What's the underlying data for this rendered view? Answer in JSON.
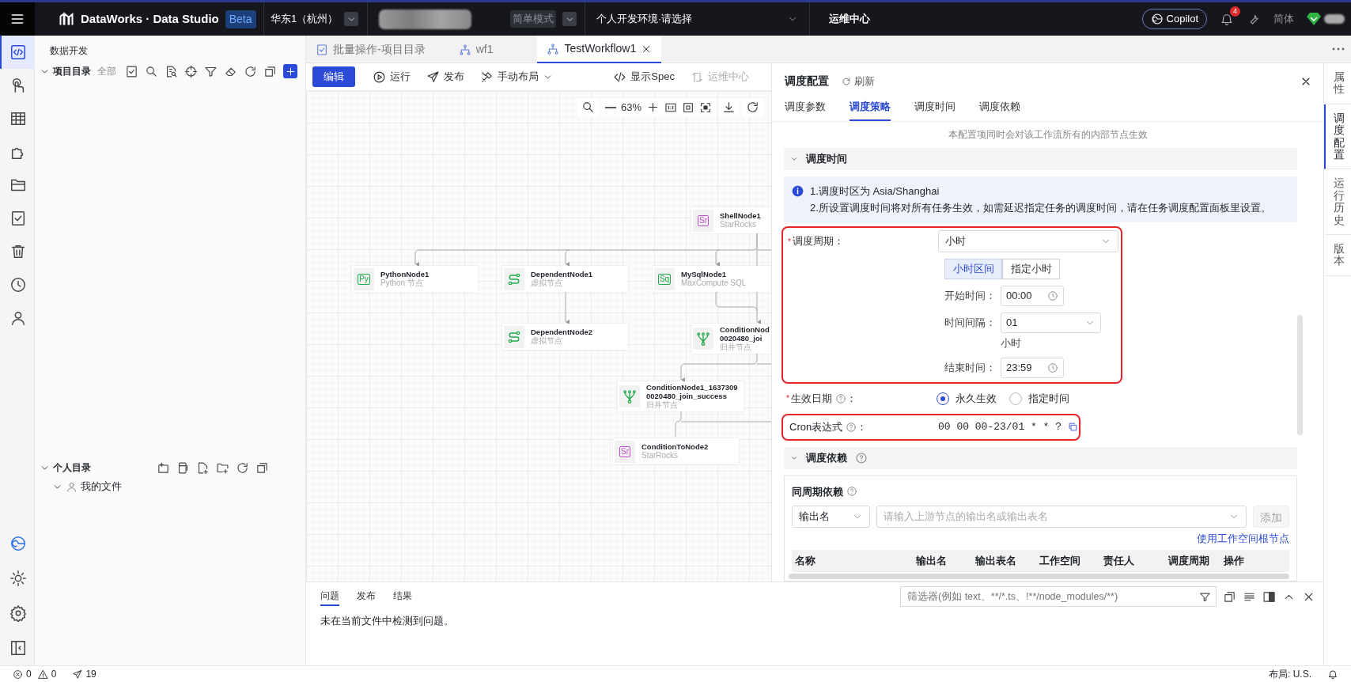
{
  "topbar": {
    "app_title": "DataWorks · Data Studio",
    "badge": "Beta",
    "region": "华东1（杭州）",
    "mode": "简单模式",
    "environment": "个人开发环境·请选择",
    "ops_link": "运维中心",
    "copilot": "Copilot",
    "notifications": "4",
    "language": "简体"
  },
  "activity_bar": {
    "items": [
      {
        "selected": true
      },
      {
        "selected": false
      },
      {
        "selected": false
      },
      {
        "selected": false
      },
      {
        "selected": false
      },
      {
        "selected": false
      },
      {
        "selected": false
      },
      {
        "selected": false
      },
      {
        "selected": false
      }
    ]
  },
  "sidebar": {
    "title": "数据开发",
    "project": {
      "label": "项目目录",
      "filter": "全部",
      "expanded": true
    },
    "personal": {
      "label": "个人目录",
      "expanded": true,
      "items": [
        {
          "label": "我的文件",
          "expanded": true
        }
      ]
    }
  },
  "editor_tabs": [
    {
      "label": "批量操作-项目目录",
      "selected": false,
      "closable": false
    },
    {
      "label": "wf1",
      "selected": false,
      "closable": false
    },
    {
      "label": "TestWorkflow1",
      "selected": true,
      "closable": true
    }
  ],
  "toolbar": [
    {
      "label": "编辑",
      "kind": "primary",
      "disabled": false
    },
    {
      "label": "运行",
      "kind": "run",
      "disabled": false
    },
    {
      "label": "发布",
      "kind": "publish",
      "disabled": false
    },
    {
      "label": "手动布局",
      "kind": "layout",
      "disabled": false
    },
    {
      "label": "显示Spec",
      "kind": "spec",
      "disabled": false
    },
    {
      "label": "运维中心",
      "kind": "ops",
      "disabled": true
    }
  ],
  "canvas": {
    "zoom": "63%",
    "nodes": [
      {
        "title_lines": [
          "ShellNode1"
        ],
        "subtitle": "StarRocks",
        "kind": "starrocks",
        "icon_text": "Sr"
      },
      {
        "title_lines": [
          "PythonNode1"
        ],
        "subtitle": "Python 节点",
        "kind": "python",
        "icon_text": "Py"
      },
      {
        "title_lines": [
          "DependentNode1"
        ],
        "subtitle": "虚拟节点",
        "kind": "virtual"
      },
      {
        "title_lines": [
          "MySqlNode1"
        ],
        "subtitle": "MaxCompute SQL",
        "kind": "sql",
        "icon_text": "Sq"
      },
      {
        "title_lines": [
          "DependentNode2"
        ],
        "subtitle": "虚拟节点",
        "kind": "virtual"
      },
      {
        "title_lines": [
          "ConditionNod",
          "0020480_joi"
        ],
        "subtitle": "归并节点",
        "kind": "merge"
      },
      {
        "title_lines": [
          "ConditionNode1_1637309",
          "0020480_join_success"
        ],
        "subtitle": "归并节点",
        "kind": "merge"
      },
      {
        "title_lines": [
          "ConditionToNode2"
        ],
        "subtitle": "StarRocks",
        "kind": "starrocks",
        "icon_text": "Sr"
      }
    ]
  },
  "config_panel": {
    "title": "调度配置",
    "refresh": "刷新",
    "tabs": [
      {
        "label": "调度参数",
        "selected": false
      },
      {
        "label": "调度策略",
        "selected": true
      },
      {
        "label": "调度时间",
        "selected": false
      },
      {
        "label": "调度依赖",
        "selected": false
      }
    ],
    "notice": "本配置项同时会对该工作流所有的内部节点生效",
    "schedule_time": {
      "title": "调度时间",
      "expanded": true,
      "info_lines": [
        "1.调度时区为 Asia/Shanghai",
        "2.所设置调度时间将对所有任务生效，如需延迟指定任务的调度时间，请在任务调度配置面板里设置。"
      ],
      "cycle": {
        "label": "调度周期：",
        "required_mark": "*",
        "value": "小时",
        "highlighted": true
      },
      "modes": [
        {
          "label": "小时区间",
          "selected": true
        },
        {
          "label": "指定小时",
          "selected": false
        }
      ],
      "start": {
        "label": "开始时间：",
        "value": "00:00"
      },
      "interval": {
        "label": "时间间隔：",
        "value": "01",
        "unit": "小时"
      },
      "end": {
        "label": "结束时间：",
        "value": "23:59"
      },
      "effective": {
        "label": "生效日期",
        "suffix": "：",
        "required_mark": "*",
        "options": [
          {
            "label": "永久生效",
            "selected": true
          },
          {
            "label": "指定时间",
            "selected": false
          }
        ]
      },
      "cron": {
        "label": "Cron表达式",
        "suffix": "：",
        "value": "00 00 00-23/01 * * ?",
        "highlighted": true
      }
    },
    "dependencies": {
      "title": "调度依赖",
      "expanded": true,
      "same_cycle": {
        "title": "同周期依赖",
        "type_select": "输出名",
        "search_placeholder": "请输入上游节点的输出名或输出表名",
        "add_button": "添加",
        "add_disabled": true,
        "root_link": "使用工作空间根节点",
        "columns": [
          "名称",
          "输出名",
          "输出表名",
          "工作空间",
          "责任人",
          "调度周期",
          "操作"
        ]
      }
    }
  },
  "right_rail": [
    {
      "label": "属性",
      "selected": false
    },
    {
      "label": "调度配置",
      "selected": true
    },
    {
      "label": "运行历史",
      "selected": false
    },
    {
      "label": "版本",
      "selected": false
    }
  ],
  "bottom_panel": {
    "tabs": [
      {
        "label": "问题",
        "selected": true
      },
      {
        "label": "发布",
        "selected": false
      },
      {
        "label": "结果",
        "selected": false
      }
    ],
    "message": "未在当前文件中检测到问题。",
    "filter_placeholder": "筛选器(例如 text、**/*.ts、!**/node_modules/**)"
  },
  "status_bar": {
    "errors": "0",
    "warnings": "0",
    "publishes": "19",
    "layout": "布局: U.S."
  }
}
